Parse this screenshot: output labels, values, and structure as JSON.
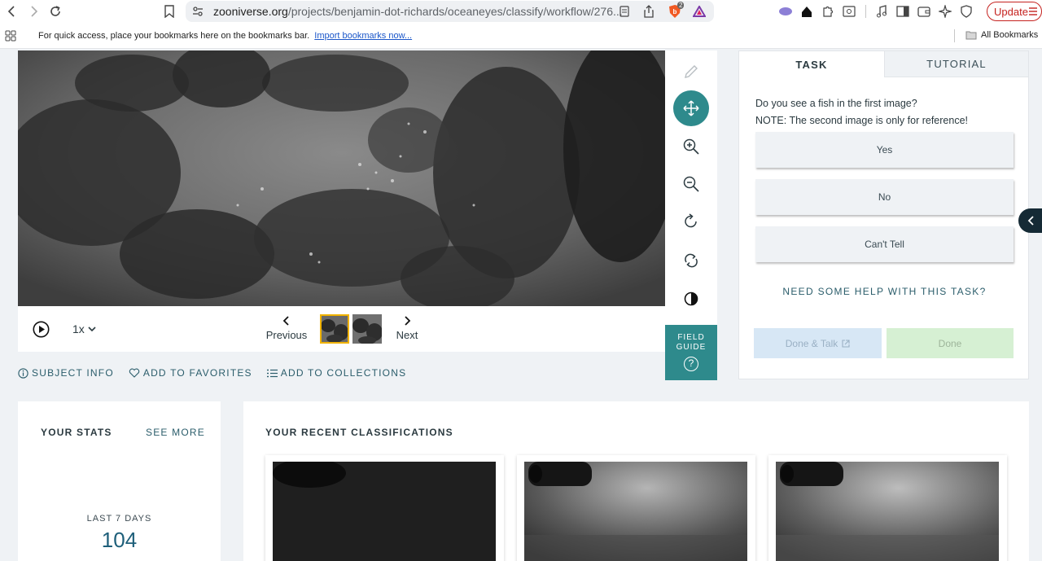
{
  "browser": {
    "url_domain": "zooniverse.org",
    "url_path": "/projects/benjamin-dot-richards/oceaneyes/classify/workflow/276...",
    "brave_count": "2",
    "update_label": "Update"
  },
  "bookmarks_bar": {
    "message": "For quick access, place your bookmarks here on the bookmarks bar.",
    "import_link": "Import bookmarks now...",
    "all_bookmarks": "All Bookmarks"
  },
  "player": {
    "speed": "1x",
    "previous_label": "Previous",
    "next_label": "Next"
  },
  "field_guide": {
    "line1": "FIELD",
    "line2": "GUIDE",
    "icon_glyph": "?"
  },
  "meta_links": {
    "subject_info": "SUBJECT INFO",
    "add_favorites": "ADD TO FAVORITES",
    "add_collections": "ADD TO COLLECTIONS"
  },
  "task_panel": {
    "tabs": [
      "TASK",
      "TUTORIAL"
    ],
    "question_line1": "Do you see a fish in the first image?",
    "question_line2": "NOTE: The second image is only for reference!",
    "answers": [
      "Yes",
      "No",
      "Can't Tell"
    ],
    "help_link": "NEED SOME HELP WITH THIS TASK?",
    "done_talk_label": "Done & Talk",
    "done_label": "Done"
  },
  "stats": {
    "title": "YOUR STATS",
    "see_more": "SEE MORE",
    "period_label": "LAST 7 DAYS",
    "count": "104"
  },
  "recent": {
    "title": "YOUR RECENT CLASSIFICATIONS"
  },
  "colors": {
    "accent_teal": "#2e8a8c",
    "link_teal": "#2b5d6b",
    "selected_thumb_border": "#f0b200",
    "page_bg": "#eff2f5"
  }
}
